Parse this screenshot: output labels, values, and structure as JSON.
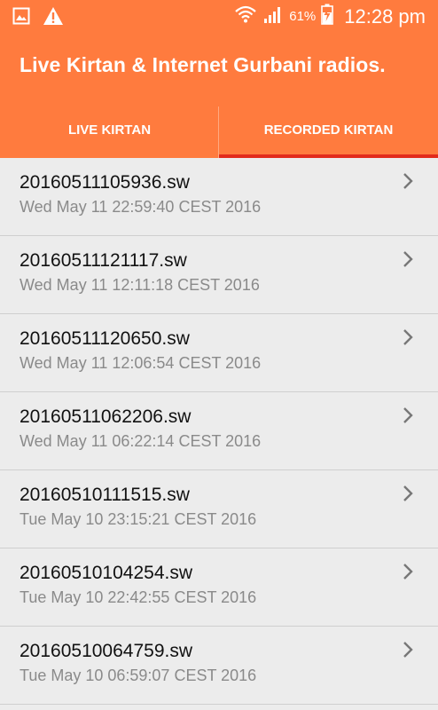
{
  "status_bar": {
    "battery_percent": "61%",
    "time": "12:28 pm",
    "icons": [
      "image-icon",
      "warning-icon",
      "wifi-icon",
      "signal-icon",
      "battery-charging-icon"
    ]
  },
  "app_bar": {
    "title": "Live Kirtan & Internet Gurbani radios."
  },
  "tabs": [
    {
      "label": "LIVE KIRTAN",
      "active": false
    },
    {
      "label": "RECORDED KIRTAN",
      "active": true
    }
  ],
  "recordings": [
    {
      "filename": "20160511105936.sw",
      "date": "Wed May 11 22:59:40 CEST 2016"
    },
    {
      "filename": "20160511121117.sw",
      "date": "Wed May 11 12:11:18 CEST 2016"
    },
    {
      "filename": "20160511120650.sw",
      "date": "Wed May 11 12:06:54 CEST 2016"
    },
    {
      "filename": "20160511062206.sw",
      "date": "Wed May 11 06:22:14 CEST 2016"
    },
    {
      "filename": "20160510111515.sw",
      "date": "Tue May 10 23:15:21 CEST 2016"
    },
    {
      "filename": "20160510104254.sw",
      "date": "Tue May 10 22:42:55 CEST 2016"
    },
    {
      "filename": "20160510064759.sw",
      "date": "Tue May 10 06:59:07 CEST 2016"
    }
  ],
  "colors": {
    "primary": "#ff7b3e",
    "tab_indicator": "#e22b1c",
    "background": "#ececec"
  }
}
